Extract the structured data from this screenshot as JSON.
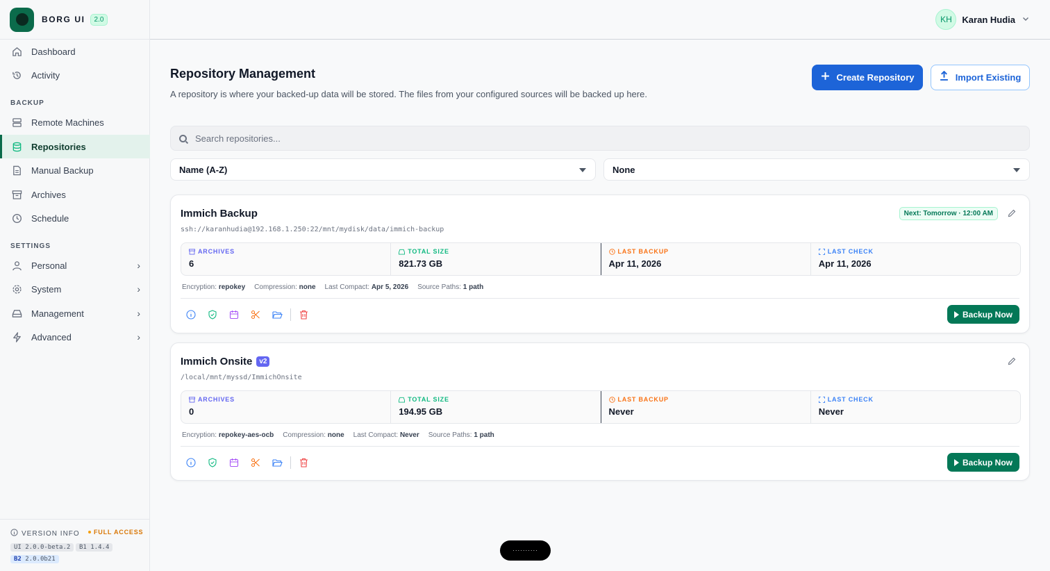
{
  "brand": {
    "name": "BORG UI",
    "version_badge": "2.0"
  },
  "nav": {
    "dashboard": "Dashboard",
    "activity": "Activity",
    "section_backup": "BACKUP",
    "remote_machines": "Remote Machines",
    "repositories": "Repositories",
    "manual_backup": "Manual Backup",
    "archives": "Archives",
    "schedule": "Schedule",
    "section_settings": "SETTINGS",
    "personal": "Personal",
    "system": "System",
    "management": "Management",
    "advanced": "Advanced"
  },
  "version_info": {
    "title": "VERSION INFO",
    "access": "FULL ACCESS",
    "ui_prefix": "UI",
    "ui_version": "2.0.0-beta.2",
    "b1_prefix": "B1",
    "b1_version": "1.4.4",
    "b2_prefix": "B2",
    "b2_version": "2.0.0b21"
  },
  "user": {
    "initials": "KH",
    "name": "Karan Hudia"
  },
  "page": {
    "title": "Repository Management",
    "description": "A repository is where your backed-up data will be stored. The files from your configured sources will be backed up here.",
    "create_label": "Create Repository",
    "import_label": "Import Existing"
  },
  "search": {
    "placeholder": "Search repositories..."
  },
  "sort": {
    "selected": "Name (A-Z)"
  },
  "group": {
    "selected": "None"
  },
  "labels": {
    "archives": "ARCHIVES",
    "total_size": "TOTAL SIZE",
    "last_backup": "LAST BACKUP",
    "last_check": "LAST CHECK",
    "encryption": "Encryption:",
    "compression": "Compression:",
    "last_compact": "Last Compact:",
    "source_paths": "Source Paths:",
    "backup_now": "Backup Now"
  },
  "repos": [
    {
      "name": "Immich Backup",
      "path": "ssh://karanhudia@192.168.1.250:22/mnt/mydisk/data/immich-backup",
      "next": "Next: Tomorrow · 12:00 AM",
      "archives": "6",
      "total_size": "821.73 GB",
      "last_backup": "Apr 11, 2026",
      "last_check": "Apr 11, 2026",
      "encryption": "repokey",
      "compression": "none",
      "last_compact": "Apr 5, 2026",
      "source_paths": "1 path"
    },
    {
      "name": "Immich Onsite",
      "tag": "v2",
      "path": "/local/mnt/myssd/ImmichOnsite",
      "archives": "0",
      "total_size": "194.95 GB",
      "last_backup": "Never",
      "last_check": "Never",
      "encryption": "repokey-aes-ocb",
      "compression": "none",
      "last_compact": "Never",
      "source_paths": "1 path"
    }
  ],
  "toast": {
    "text": "··········"
  },
  "colors": {
    "accent": "#0b6b4b",
    "primary": "#1d64d8",
    "backup_button": "#047857"
  }
}
